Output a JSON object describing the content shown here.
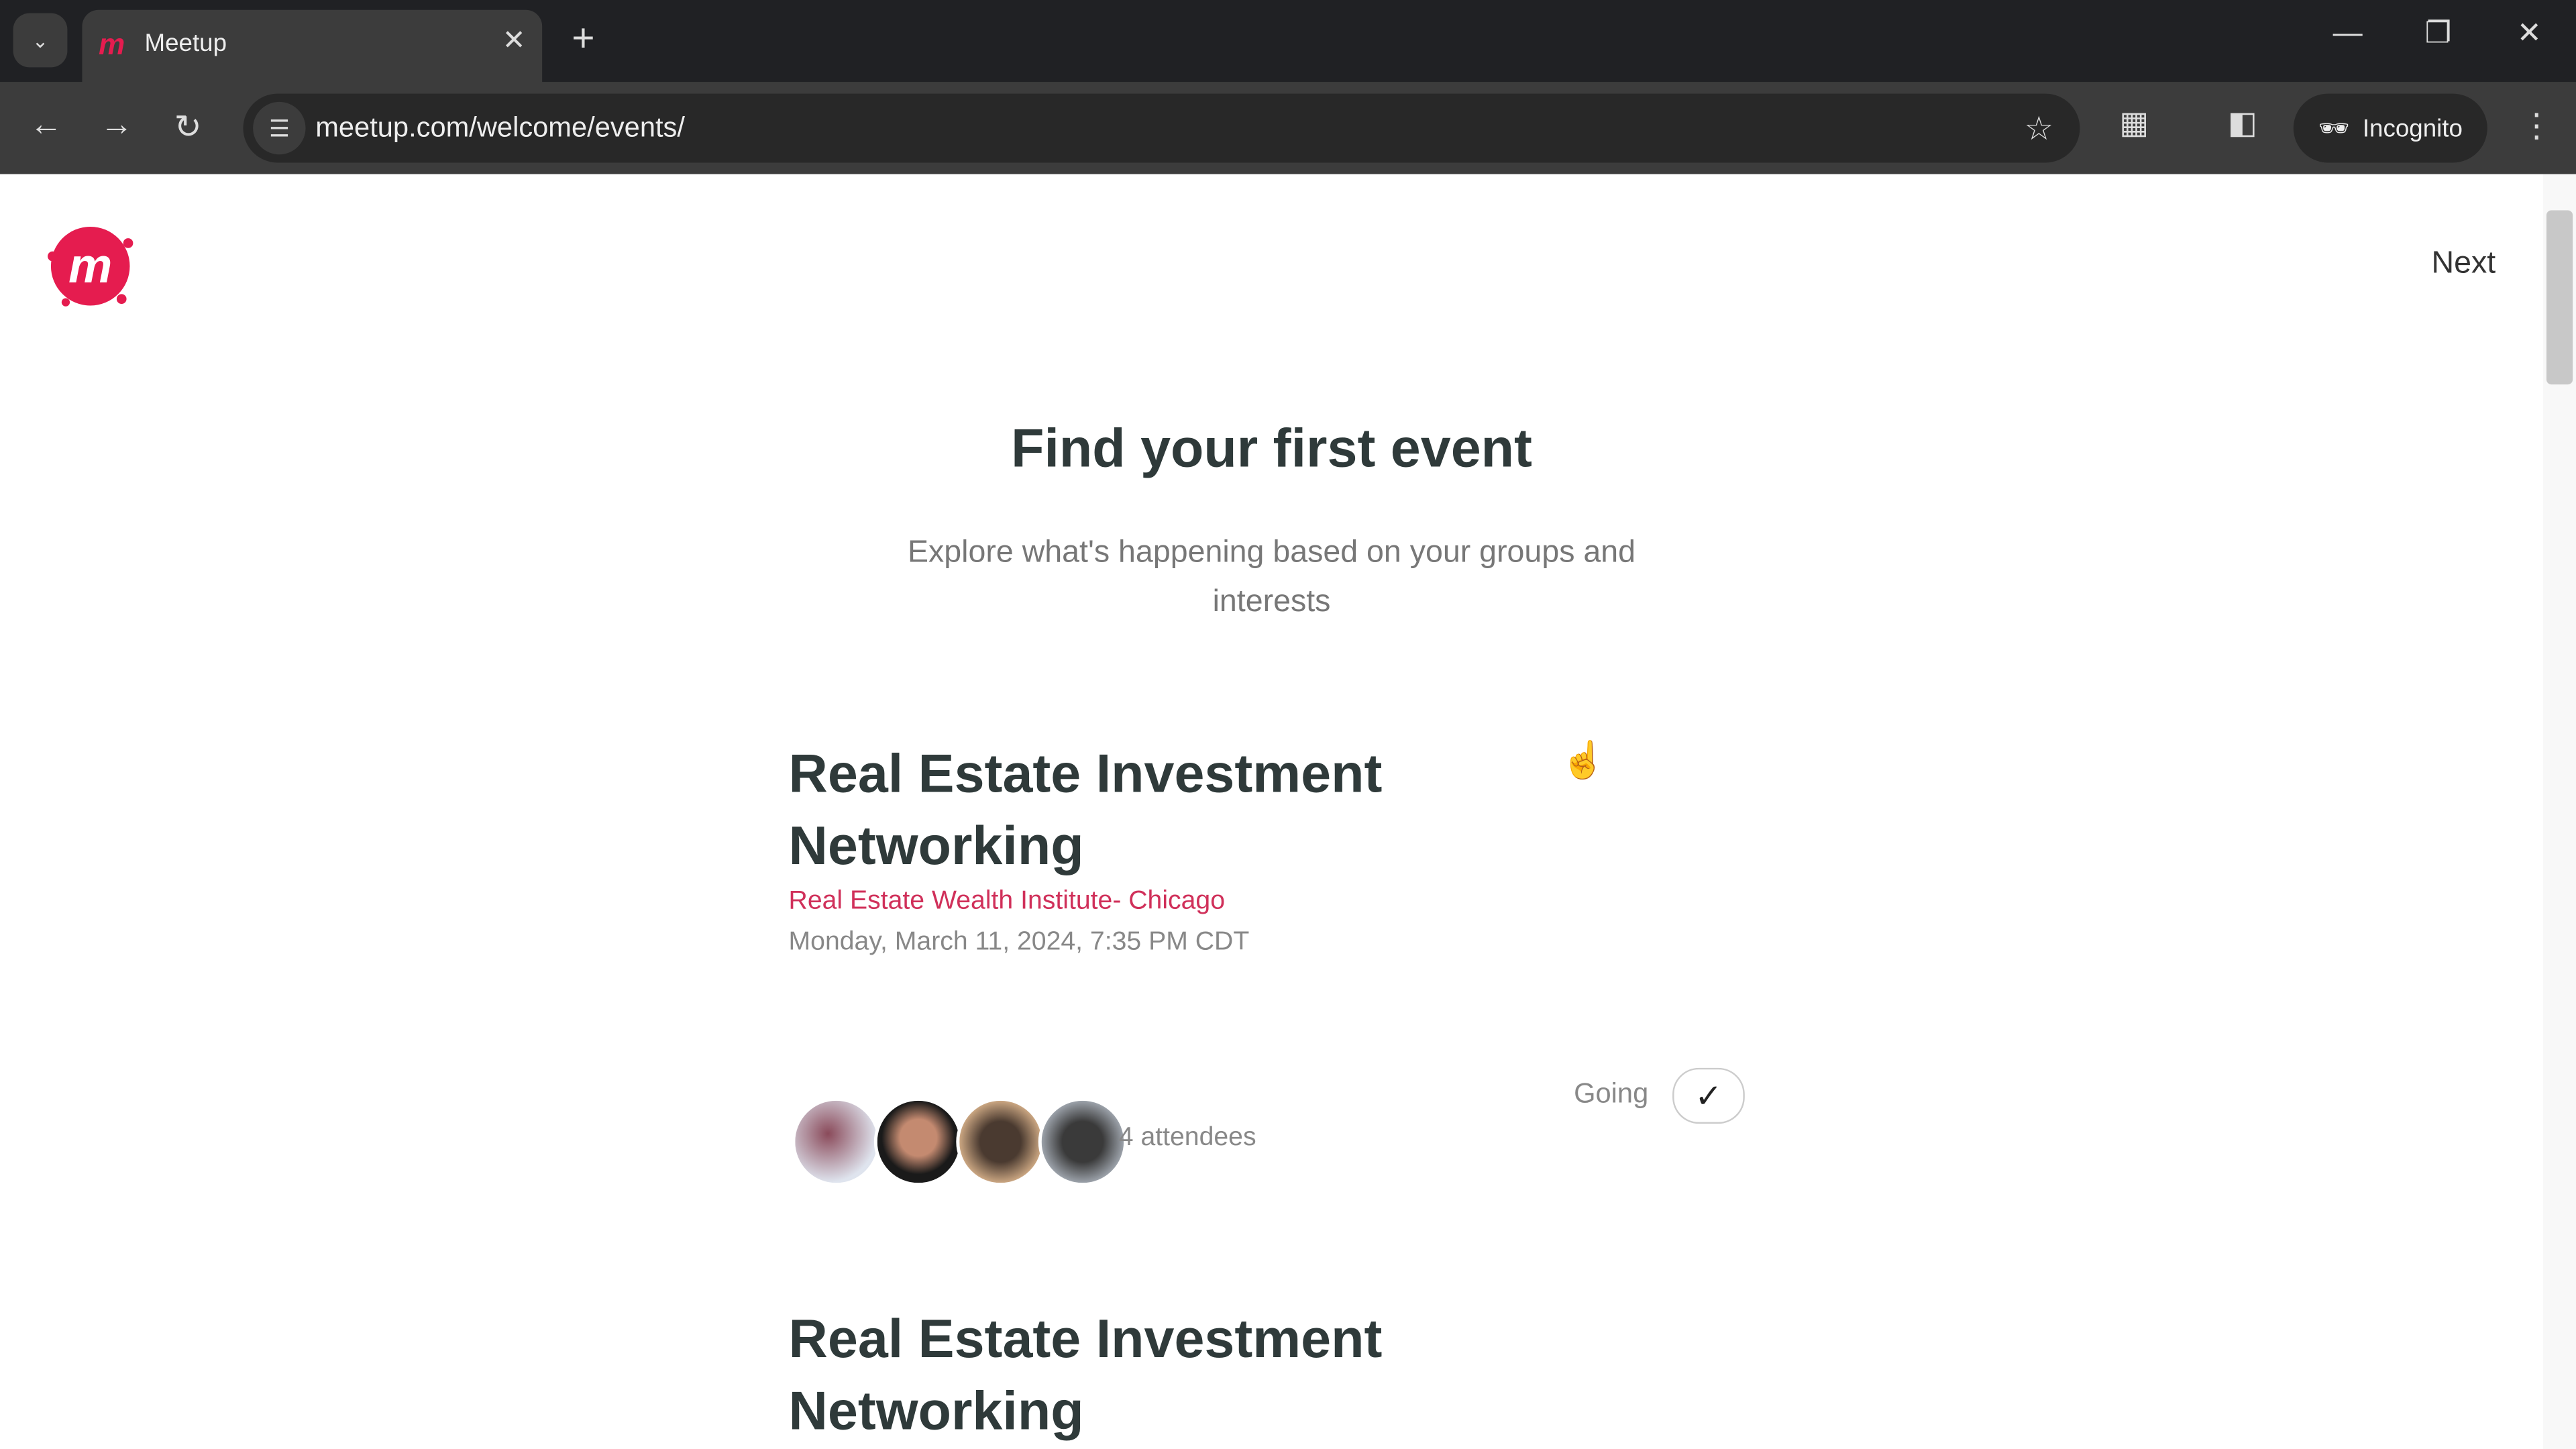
{
  "browser": {
    "tab_title": "Meetup",
    "url": "meetup.com/welcome/events/",
    "incognito_label": "Incognito",
    "icons": [
      "chevron-down-icon",
      "meetup-favicon",
      "close-icon",
      "plus-icon",
      "minimize-icon",
      "restore-icon",
      "close-window-icon",
      "back-icon",
      "forward-icon",
      "reload-icon",
      "site-settings-icon",
      "star-icon",
      "extensions-icon",
      "side-panel-icon",
      "incognito-icon",
      "kebab-menu-icon"
    ]
  },
  "header": {
    "next_label": "Next",
    "brand_color": "#e51c4f"
  },
  "main": {
    "title": "Find your first event",
    "subtitle": "Explore what's happening based on your groups and interests",
    "events": [
      {
        "title": "Real Estate Investment Networking",
        "group": "Real Estate Wealth Institute- Chicago",
        "date": "Monday, March 11, 2024, 7:35 PM CDT",
        "attendees": "4 attendees",
        "rsvp_label": "Going"
      },
      {
        "title": "Real Estate Investment Networking"
      }
    ]
  }
}
